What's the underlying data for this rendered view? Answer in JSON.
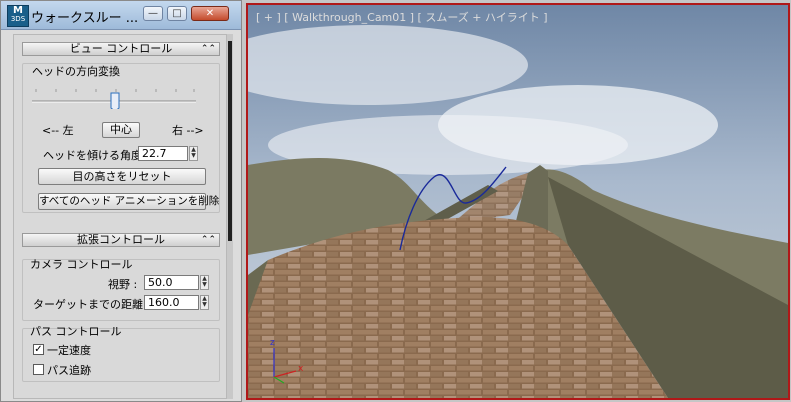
{
  "window": {
    "title": "ウォークスルー ...",
    "app_icon_text": "M\n3DS",
    "minimize": "—",
    "maximize": "□",
    "close": "✕"
  },
  "view_control": {
    "header": "ビュー コントロール",
    "chevron": "⌃⌃",
    "group_title": "ヘッドの方向変換",
    "slider_fraction": 0.5,
    "left_label": "<-- 左",
    "center_button": "中心",
    "right_label": "右 -->",
    "tilt_label": "ヘッドを傾ける角度",
    "tilt_value": "22.7",
    "reset_height_button": "目の高さをリセット",
    "delete_anim_button": "すべてのヘッド アニメーションを削除"
  },
  "advanced_control": {
    "header": "拡張コントロール",
    "chevron": "⌃⌃",
    "camera_group": "カメラ コントロール",
    "fov_label": "視野 :",
    "fov_value": "50.0",
    "target_dist_label": "ターゲットまでの距離 :",
    "target_dist_value": "160.0",
    "path_group": "パス コントロール",
    "constant_speed_label": "一定速度",
    "constant_speed_checked": true,
    "follow_path_label": "パス追跡",
    "follow_path_checked": false
  },
  "viewport": {
    "label": "[ + ] [ Walkthrough_Cam01 ] [ スムーズ + ハイライト ]",
    "axis_x": "x",
    "axis_z": "z",
    "border_color": "#b01818"
  }
}
